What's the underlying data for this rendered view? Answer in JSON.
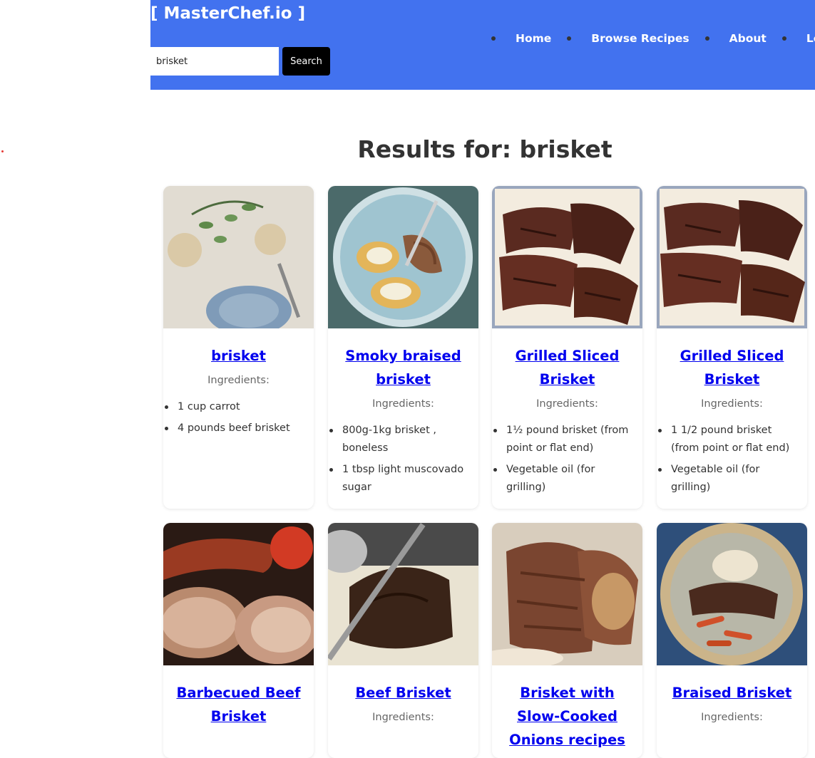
{
  "header": {
    "brand": "[ MasterChef.io ]",
    "search": {
      "value": "brisket",
      "button_label": "Search"
    },
    "nav": [
      {
        "label": "Home"
      },
      {
        "label": "Browse Recipes"
      },
      {
        "label": "About"
      },
      {
        "label": "Login"
      }
    ],
    "background_color": "#4272ef"
  },
  "results": {
    "title": "Results for: brisket",
    "ingredients_label": "Ingredients:",
    "recipes": [
      {
        "title": "brisket",
        "image": "table-setting-image",
        "ingredients": [
          "1 cup carrot",
          "4 pounds beef brisket"
        ]
      },
      {
        "title": "Smoky braised brisket",
        "image": "brisket-potatoes-plate-image",
        "ingredients": [
          "800g-1kg brisket , boneless",
          "1 tbsp light muscovado sugar"
        ]
      },
      {
        "title": "Grilled Sliced Brisket",
        "image": "grilled-brisket-image",
        "ingredients": [
          "1½ pound brisket (from point or flat end)",
          "Vegetable oil (for grilling)"
        ]
      },
      {
        "title": "Grilled Sliced Brisket",
        "image": "grilled-brisket-image",
        "ingredients": [
          "1 1/2 pound brisket (from point or flat end)",
          "Vegetable oil (for grilling)"
        ]
      },
      {
        "title": "Barbecued Beef Brisket",
        "image": "sausage-tomato-roast-image",
        "ingredients": []
      },
      {
        "title": "Beef Brisket",
        "image": "slicing-brisket-image",
        "ingredients": []
      },
      {
        "title": "Brisket with Slow-Cooked Onions recipes",
        "image": "brisket-onions-image",
        "ingredients": []
      },
      {
        "title": "Braised Brisket",
        "image": "braised-brisket-bowl-image",
        "ingredients": []
      }
    ]
  }
}
